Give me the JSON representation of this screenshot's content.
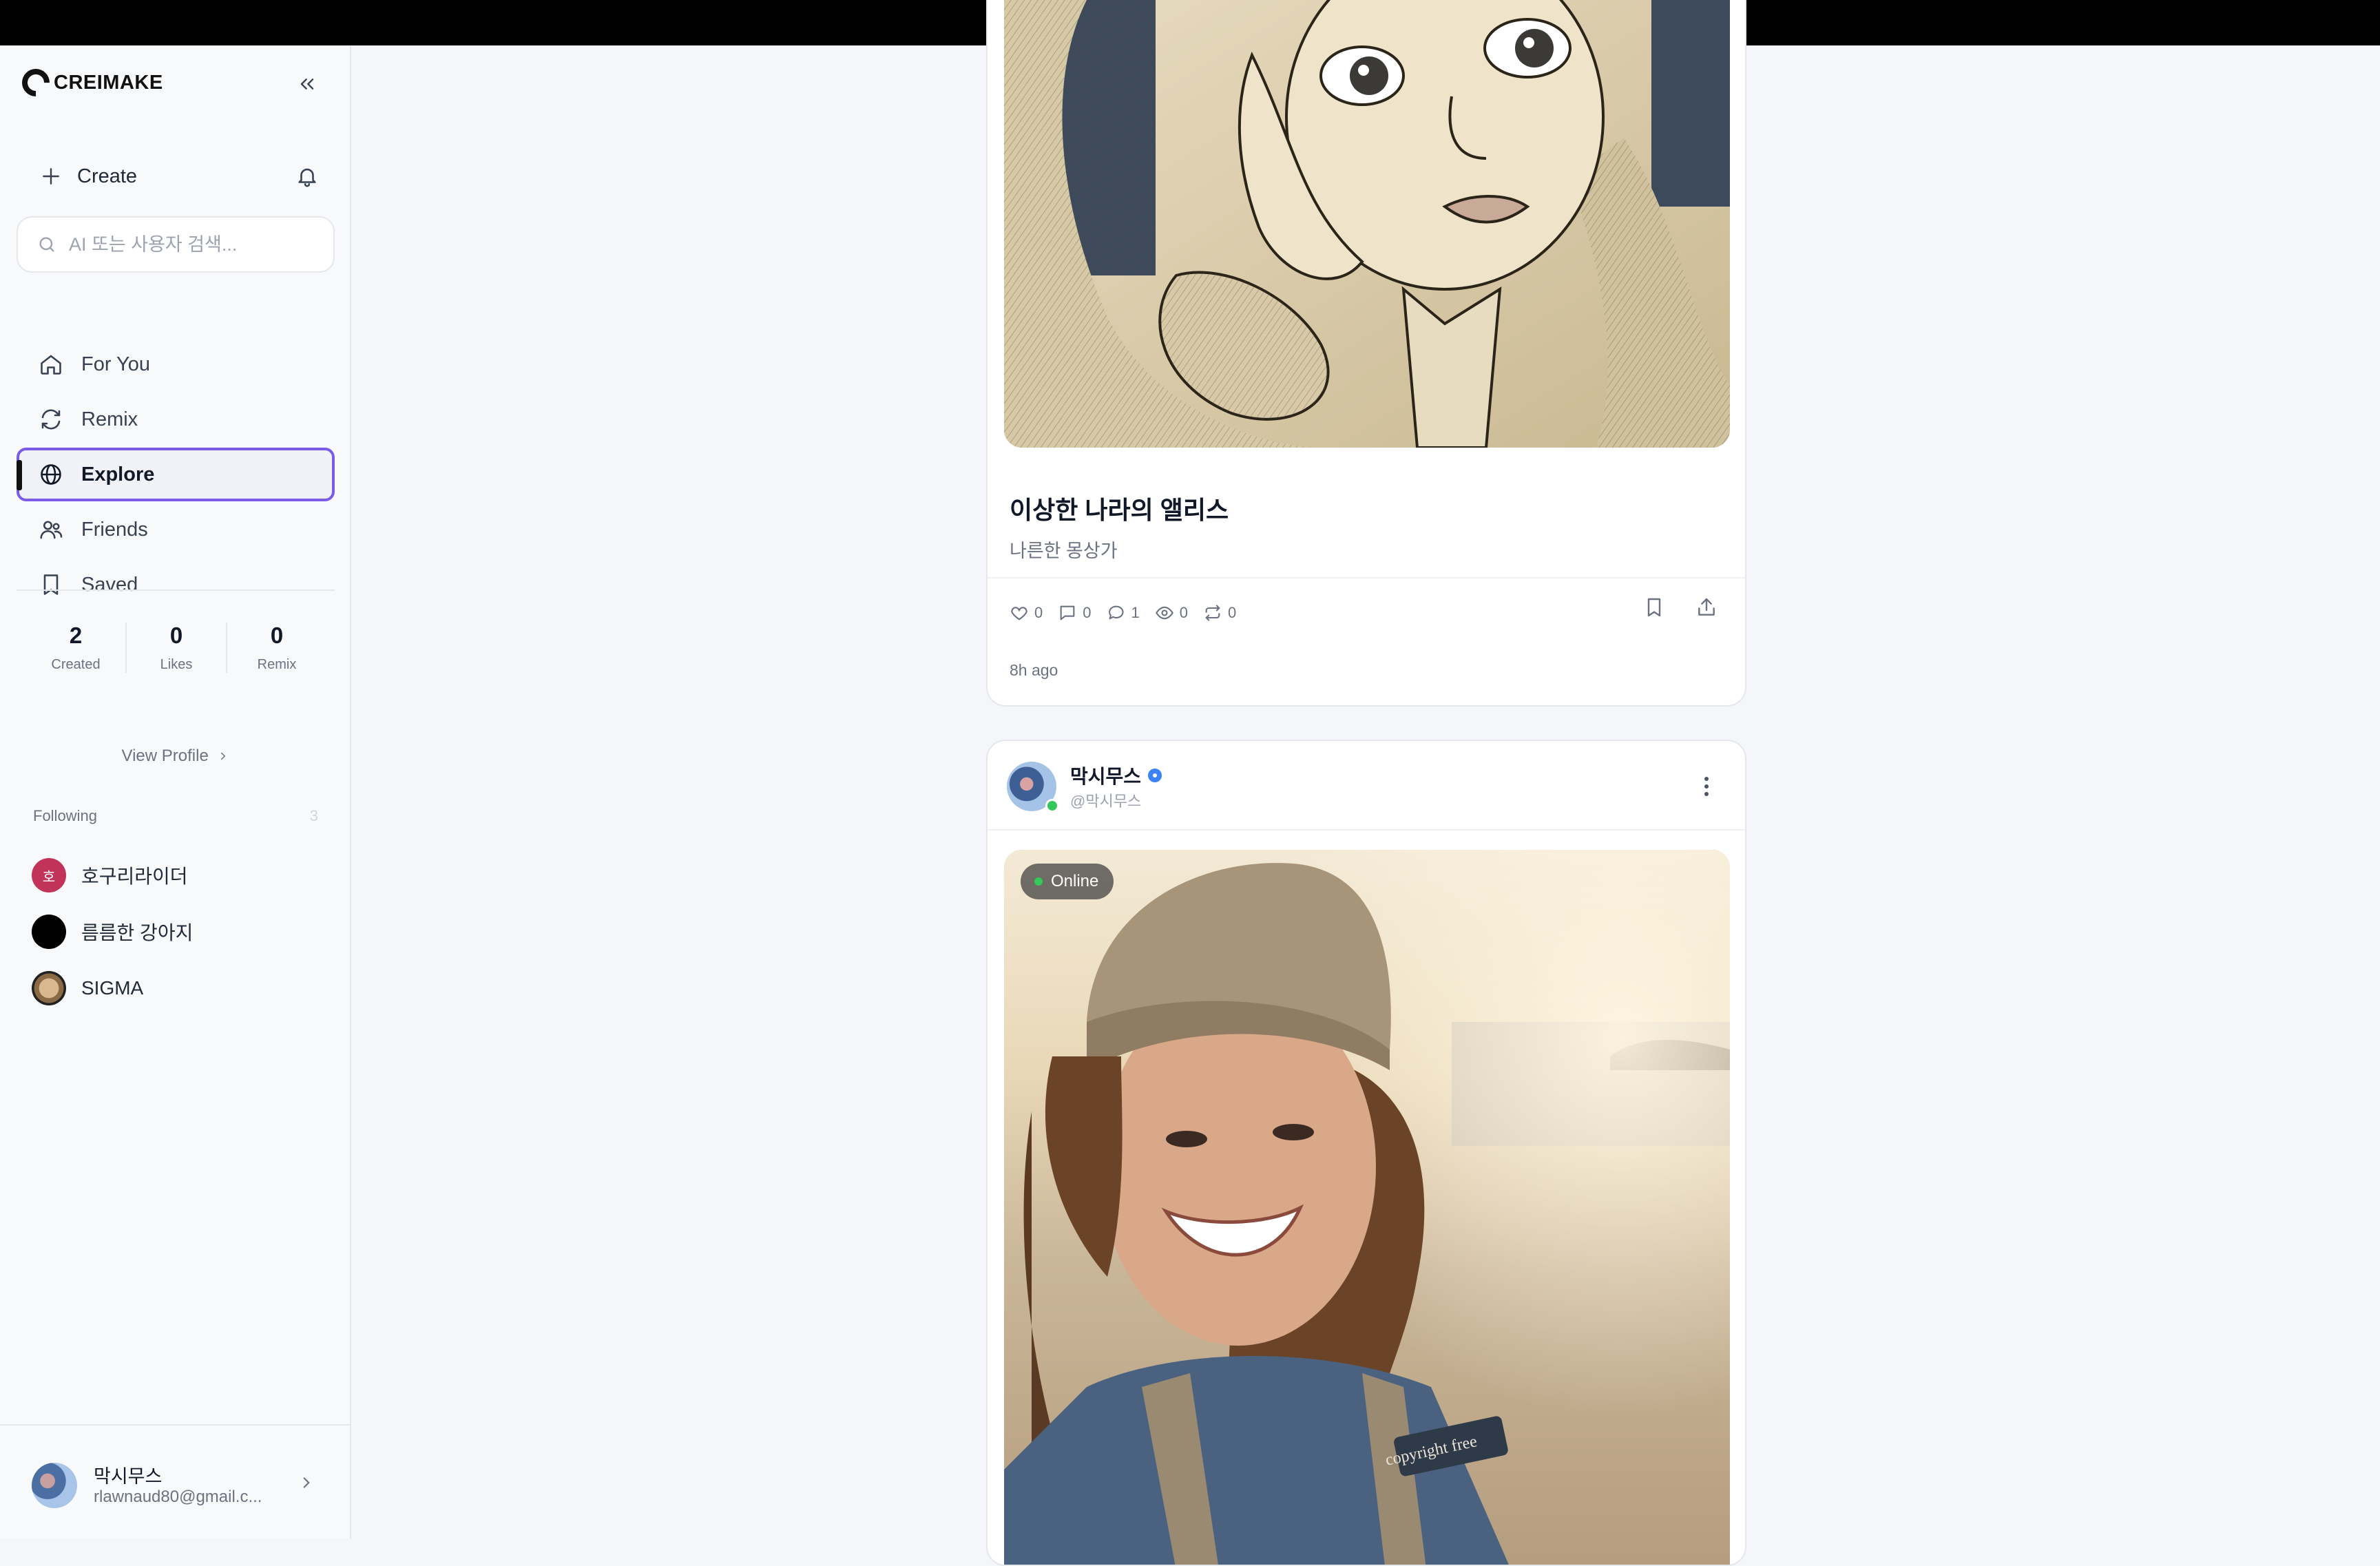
{
  "brand": {
    "name": "CREIMAKE"
  },
  "sidebar": {
    "create_label": "Create",
    "search": {
      "placeholder": "AI 또는 사용자 검색..."
    },
    "nav": [
      {
        "label": "For You",
        "icon": "home-icon"
      },
      {
        "label": "Remix",
        "icon": "remix-icon"
      },
      {
        "label": "Explore",
        "icon": "globe-icon",
        "active": true
      },
      {
        "label": "Friends",
        "icon": "friends-icon"
      },
      {
        "label": "Saved",
        "icon": "bookmark-icon"
      }
    ],
    "stats": [
      {
        "value": "2",
        "label": "Created"
      },
      {
        "value": "0",
        "label": "Likes"
      },
      {
        "value": "0",
        "label": "Remix"
      }
    ],
    "view_profile": "View Profile",
    "following": {
      "title": "Following",
      "count": "3",
      "items": [
        {
          "name": "호구리라이더",
          "initial": "호",
          "color": "#c2335a"
        },
        {
          "name": "름름한 강아지",
          "initial": "",
          "color": "#000000"
        },
        {
          "name": "SIGMA",
          "initial": "",
          "color": "#b89a72"
        }
      ]
    },
    "user": {
      "name": "막시무스",
      "email": "rlawnaud80@gmail.c..."
    }
  },
  "feed": {
    "post1": {
      "title": "이상한 나라의 앨리스",
      "subtitle": "나른한 몽상가",
      "stats": {
        "likes": "0",
        "comments": "0",
        "chats": "1",
        "views": "0",
        "remixes": "0"
      },
      "time": "8h ago"
    },
    "post2": {
      "author": "막시무스",
      "handle": "@막시무스",
      "badge": "Online",
      "image_text": "copyright free"
    }
  },
  "colors": {
    "accent": "#7c5ce6",
    "online": "#34c759",
    "verified": "#3b82f6",
    "topbar": "#000000"
  }
}
